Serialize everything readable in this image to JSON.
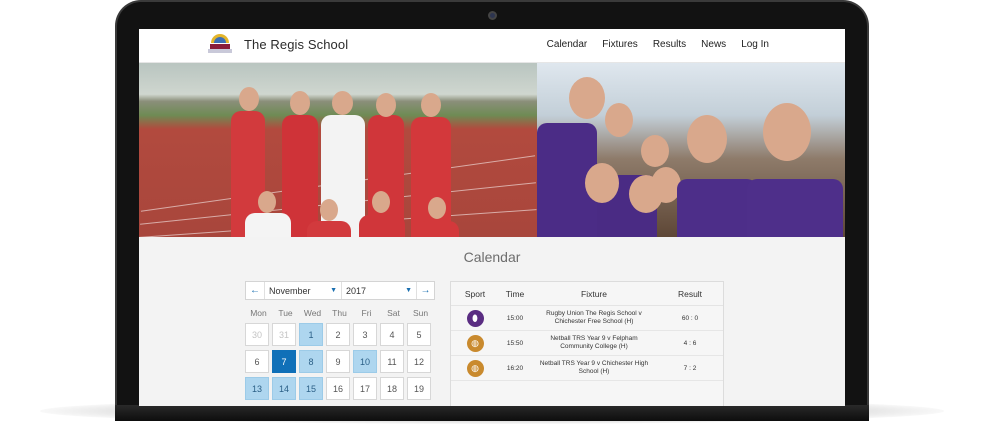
{
  "site": {
    "name": "The Regis School",
    "nav": [
      "Calendar",
      "Fixtures",
      "Results",
      "News",
      "Log In"
    ]
  },
  "calendar": {
    "heading": "Calendar",
    "month": "November",
    "year": "2017",
    "prev_arrow": "←",
    "next_arrow": "→",
    "weekdays": [
      "Mon",
      "Tue",
      "Wed",
      "Thu",
      "Fri",
      "Sat",
      "Sun"
    ],
    "days": [
      {
        "d": "30",
        "state": "muted"
      },
      {
        "d": "31",
        "state": "muted"
      },
      {
        "d": "1",
        "state": "event"
      },
      {
        "d": "2",
        "state": ""
      },
      {
        "d": "3",
        "state": ""
      },
      {
        "d": "4",
        "state": ""
      },
      {
        "d": "5",
        "state": ""
      },
      {
        "d": "6",
        "state": ""
      },
      {
        "d": "7",
        "state": "today"
      },
      {
        "d": "8",
        "state": "event"
      },
      {
        "d": "9",
        "state": ""
      },
      {
        "d": "10",
        "state": "event"
      },
      {
        "d": "11",
        "state": ""
      },
      {
        "d": "12",
        "state": ""
      },
      {
        "d": "13",
        "state": "event"
      },
      {
        "d": "14",
        "state": "event"
      },
      {
        "d": "15",
        "state": "event"
      },
      {
        "d": "16",
        "state": ""
      },
      {
        "d": "17",
        "state": ""
      },
      {
        "d": "18",
        "state": ""
      },
      {
        "d": "19",
        "state": ""
      }
    ]
  },
  "fixtures": {
    "headers": {
      "sport": "Sport",
      "time": "Time",
      "fixture": "Fixture",
      "result": "Result"
    },
    "rows": [
      {
        "icon": "rugby-icon",
        "color": "#5a2d82",
        "time": "15:00",
        "fixture": "Rugby Union The Regis School v Chichester Free School (H)",
        "result": "60 : 0"
      },
      {
        "icon": "netball-icon",
        "color": "#c98a2e",
        "time": "15:50",
        "fixture": "Netball TRS Year 9 v Felpham Community College (H)",
        "result": "4 : 6"
      },
      {
        "icon": "netball-icon",
        "color": "#c98a2e",
        "time": "16:20",
        "fixture": "Netball TRS Year 9 v Chichester High School (H)",
        "result": "7 : 2"
      }
    ]
  }
}
